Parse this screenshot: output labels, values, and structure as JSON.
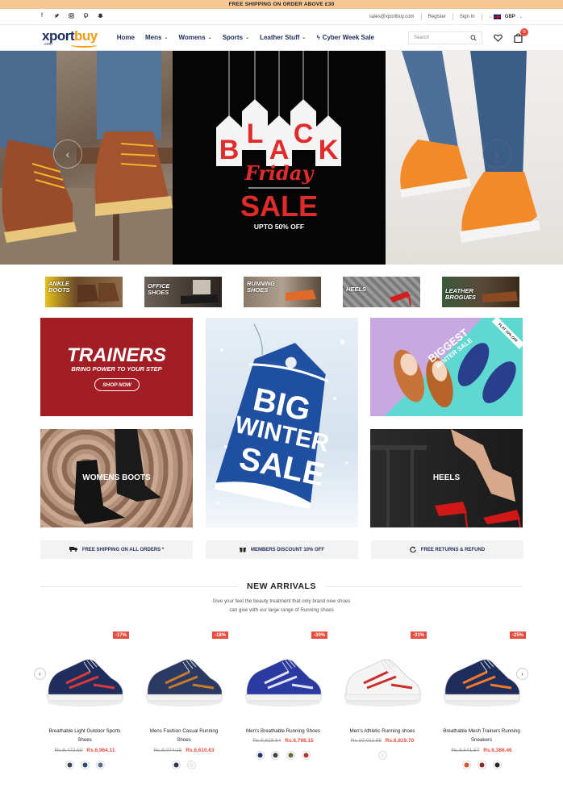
{
  "topbar": {
    "text": "FREE SHIPPING ON ORDER ABOVE £30"
  },
  "util": {
    "email": "sales@xportbuy.com",
    "register": "Register",
    "signin": "Sign In",
    "currency": "GBP"
  },
  "header": {
    "logo_main_1": "xport",
    "logo_main_2": "buy",
    "logo_sub": ".com",
    "nav": [
      {
        "label": "Home"
      },
      {
        "label": "Mens"
      },
      {
        "label": "Womens"
      },
      {
        "label": "Sports"
      },
      {
        "label": "Leather Stuff"
      },
      {
        "label": "Cyber Week Sale"
      }
    ],
    "search_placeholder": "Search",
    "cart_count": "0"
  },
  "hero": {
    "tags": [
      "B",
      "L",
      "A",
      "C",
      "K"
    ],
    "friday": "Friday",
    "sale": "SALE",
    "upto": "UPTO 50% OFF"
  },
  "categories": [
    {
      "label_1": "ANKLE",
      "label_2": "BOOTS"
    },
    {
      "label_1": "OFFICE",
      "label_2": "SHOES"
    },
    {
      "label_1": "RUNNING",
      "label_2": "SHOES"
    },
    {
      "label_1": "HEELS",
      "label_2": ""
    },
    {
      "label_1": "LEATHER",
      "label_2": "BROGUES"
    }
  ],
  "promos": {
    "trainers_title": "TRAINERS",
    "trainers_sub": "BRING POWER TO YOUR STEP",
    "trainers_btn": "SHOP NOW",
    "winter_1": "BIG",
    "winter_2": "WINTER",
    "winter_3": "SALE",
    "biggest_1": "BIGGEST",
    "biggest_2": "WINTER SALE",
    "flat": "FLAT 10% OFF",
    "womens_boots": "WOMENS BOOTS",
    "heels": "HEELS"
  },
  "features": [
    {
      "label": "FREE SHIPPING ON ALL ORDERS *"
    },
    {
      "label": "MEMBERS DISCOUNT 10% OFF"
    },
    {
      "label": "FREE RETURNS & REFUND"
    }
  ],
  "new_arrivals": {
    "title": "NEW ARRIVALS",
    "sub_1": "Give your feet the beauty treatment that only brand new shoes",
    "sub_2": "can give with our large range of Running shoes"
  },
  "products": [
    {
      "discount": "-17%",
      "name_1": "Breathable Light Outdoor Sports",
      "name_2": "Shoes",
      "old": "Rs.8,472.50",
      "new": "Rs.6,964.11",
      "swatches": [
        "#3b4a5a",
        "#2c4f7c",
        "#5a6b8c"
      ],
      "shoe_color": "#1f2d5c",
      "accent": "#d93a3a"
    },
    {
      "discount": "-18%",
      "name_1": "Mens Fashion Casual Running",
      "name_2": "Shoes",
      "old": "Rs.8,074.15",
      "new": "Rs.6,610.63",
      "swatches": [
        "#2a3550",
        "#eeeeee"
      ],
      "shoe_color": "#2a3a62",
      "accent": "#c77a2d"
    },
    {
      "discount": "-30%",
      "name_1": "Men's Breathable Running Shoes",
      "name_2": "",
      "old": "Rs.9,828.64",
      "new": "Rs.6,798.15",
      "swatches": [
        "#26346b",
        "#444444",
        "#6b6b3b",
        "#b23a3a"
      ],
      "shoe_color": "#2a3aa0",
      "accent": "#dfe3f0"
    },
    {
      "discount": "-31%",
      "name_1": "Men's Athletic Running shoes",
      "name_2": "",
      "old": "Rs.10,011.85",
      "new": "Rs.6,819.70",
      "swatches": [
        "#f2f2f2"
      ],
      "shoe_color": "#f4f4f4",
      "accent": "#c9302c"
    },
    {
      "discount": "-25%",
      "name_1": "Breathable Mesh Trainers Running",
      "name_2": "Sneakers",
      "old": "Rs.8,541.57",
      "new": "Rs.6,386.46",
      "swatches": [
        "#d2592a",
        "#8b2a2a",
        "#2a2a2a"
      ],
      "shoe_color": "#1f2d5c",
      "accent": "#f07a2a"
    }
  ],
  "colors": {
    "accent": "#e74c3c",
    "navy": "#1b2d5b",
    "topbar": "#f7c695"
  },
  "icons": [
    "facebook-icon",
    "twitter-icon",
    "instagram-icon",
    "pinterest-icon",
    "snapchat-icon",
    "search-icon",
    "heart-icon",
    "bag-icon",
    "truck-icon",
    "gift-icon",
    "refresh-icon",
    "chevron-left-icon",
    "chevron-right-icon"
  ]
}
